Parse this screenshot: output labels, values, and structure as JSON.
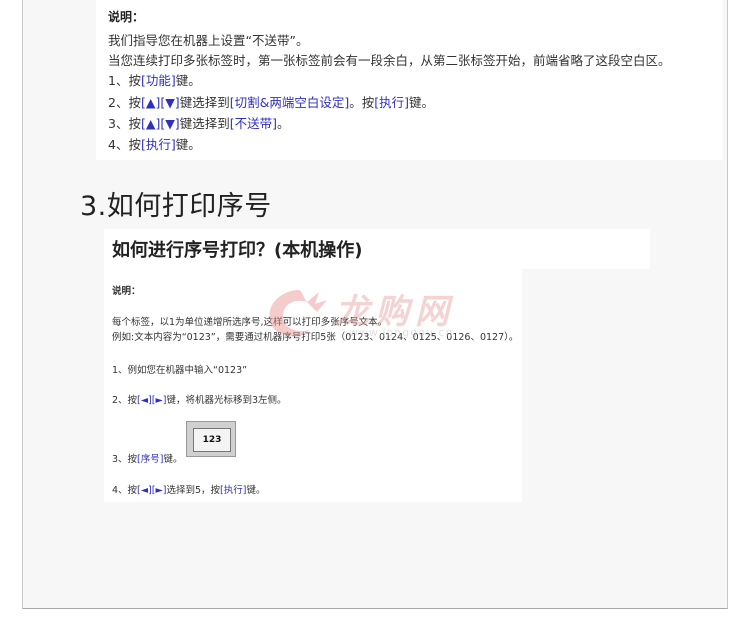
{
  "card1": {
    "title": "说明：",
    "line1": "我们指导您在机器上设置“不送带”。",
    "line2": "当您连续打印多张标签时，第一张标签前会有一段余白，从第二张标签开始，前端省略了这段空白区。",
    "step1": {
      "pre": "1、按",
      "key": "[功能]",
      "post": "键。"
    },
    "step2": {
      "pre": "2、按",
      "key1": "[▲][▼]",
      "mid": "键选择到",
      "key2": "[切割&两端空白设定]",
      "mid2": "。按",
      "key3": "[执行]",
      "post": "键。"
    },
    "step3": {
      "pre": "3、按",
      "key1": "[▲][▼]",
      "mid": "键选择到",
      "key2": "[不送带]",
      "post": "。"
    },
    "step4": {
      "pre": "4、按",
      "key": "[执行]",
      "post": "键。"
    }
  },
  "section_title": "3.如何打印序号",
  "card2": {
    "title": "如何进行序号打印？(本机操作)"
  },
  "card3": {
    "label": "说明：",
    "line1": "每个标签，以1为单位递增所选序号,这样可以打印多张序号文本。",
    "line2": "例如:文本内容为“0123”，需要通过机器序号打印5张（0123、0124、0125、0126、0127）。",
    "step1": "1、例如您在机器中输入“0123”",
    "step2": {
      "pre": "2、按",
      "key": "[◄][►]",
      "post": "键，将机器光标移到3左侧。"
    },
    "step3": {
      "pre": "3、按",
      "key": "[序号]",
      "post": "键。"
    },
    "step4": {
      "pre": "4、按",
      "key1": "[◄][►]",
      "mid": "选择到5，按",
      "key2": "[执行]",
      "post": "键。"
    }
  },
  "key_image_text": "123",
  "watermark": {
    "text": "龙购网",
    "url": "www.longgou.cn"
  }
}
